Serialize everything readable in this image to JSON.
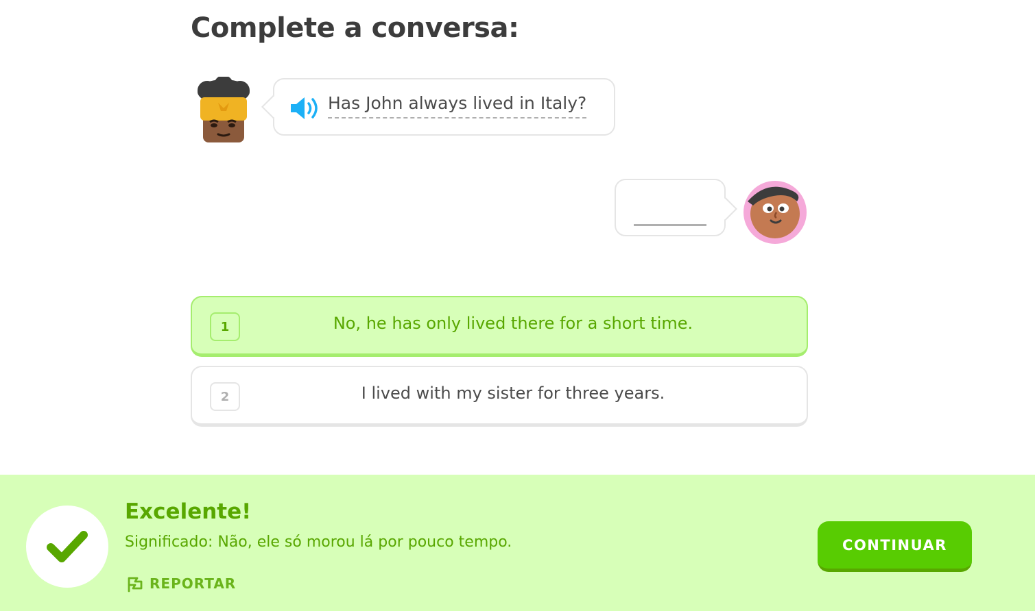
{
  "header": {
    "title": "Complete a conversa:"
  },
  "prompt": {
    "text": "Has John always lived in Italy?",
    "audio_icon": "speaker-icon"
  },
  "answer_blank": {
    "icon": "blank-underline"
  },
  "options": [
    {
      "number": "1",
      "text": "No, he has only lived there for a short time.",
      "selected": true
    },
    {
      "number": "2",
      "text": "I lived with my sister for three years.",
      "selected": false
    }
  ],
  "feedback": {
    "title": "Excelente!",
    "meaning": "Significado: Não, ele só morou lá por pouco tempo.",
    "report_label": "REPORTAR",
    "continue_label": "CONTINUAR",
    "icon": "checkmark-icon"
  },
  "colors": {
    "correct_green": "#58a700",
    "correct_bg": "#d7ffb8",
    "button_green": "#58cc02",
    "border_gray": "#e5e5e5",
    "audio_blue": "#1cb0f6"
  }
}
